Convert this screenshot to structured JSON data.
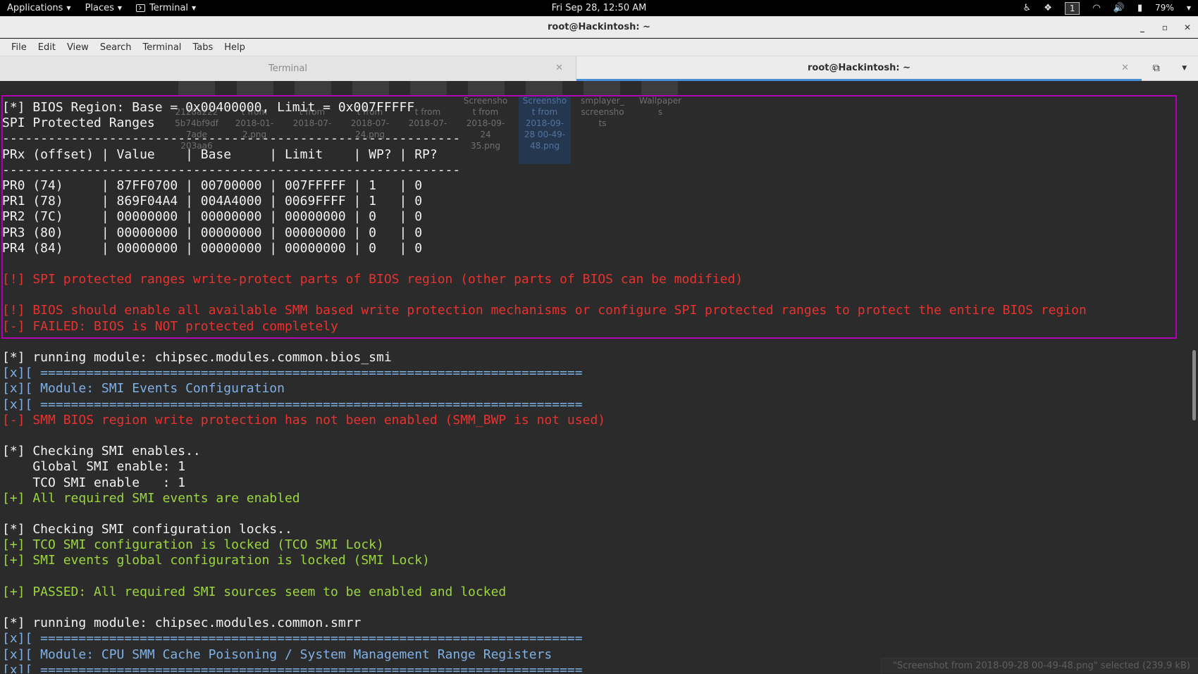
{
  "topbar": {
    "applications": "Applications",
    "places": "Places",
    "terminal": "Terminal",
    "clock": "Fri Sep 28, 12:50 AM",
    "workspace": "1",
    "battery": "79%"
  },
  "window": {
    "title": "root@Hackintosh: ~"
  },
  "menubar": {
    "items": [
      "File",
      "Edit",
      "View",
      "Search",
      "Terminal",
      "Tabs",
      "Help"
    ]
  },
  "tabs": [
    {
      "label": "Terminal",
      "active": false
    },
    {
      "label": "root@Hackintosh: ~",
      "active": true
    }
  ],
  "desktop_ghosts": {
    "files": [
      "2128a222\n5b74bf9df\n7ade\n203aa6",
      "t from\n2018-01-\n2.png",
      "t from\n2018-07-",
      "t from\n2018-07-\n24.png",
      "t from\n2018-07-",
      "Screensho\nt from\n2018-09-\n24\n35.png",
      "Screensho\nt from\n2018-09-\n28 00-49-\n48.png",
      "smplayer_\nscreensho\nts",
      "Wallpaper\ns"
    ],
    "status": "\"Screenshot from 2018-09-28 00-49-48.png\" selected (239.9 kB)"
  },
  "terminal": {
    "lines": [
      {
        "text": "[*] BIOS Region: Base = 0x00400000, Limit = 0x007FFFFF",
        "color": "white"
      },
      {
        "text": "SPI Protected Ranges",
        "color": "white"
      },
      {
        "text": "------------------------------------------------------------",
        "color": "white"
      },
      {
        "text": "PRx (offset) | Value    | Base     | Limit    | WP? | RP?",
        "color": "white"
      },
      {
        "text": "------------------------------------------------------------",
        "color": "white"
      },
      {
        "text": "PR0 (74)     | 87FF0700 | 00700000 | 007FFFFF | 1   | 0",
        "color": "white"
      },
      {
        "text": "PR1 (78)     | 869F04A4 | 004A4000 | 0069FFFF | 1   | 0",
        "color": "white"
      },
      {
        "text": "PR2 (7C)     | 00000000 | 00000000 | 00000000 | 0   | 0",
        "color": "white"
      },
      {
        "text": "PR3 (80)     | 00000000 | 00000000 | 00000000 | 0   | 0",
        "color": "white"
      },
      {
        "text": "PR4 (84)     | 00000000 | 00000000 | 00000000 | 0   | 0",
        "color": "white"
      },
      {
        "text": "",
        "color": "white"
      },
      {
        "text": "[!] SPI protected ranges write-protect parts of BIOS region (other parts of BIOS can be modified)",
        "color": "red"
      },
      {
        "text": "",
        "color": "white"
      },
      {
        "text": "[!] BIOS should enable all available SMM based write protection mechanisms or configure SPI protected ranges to protect the entire BIOS region",
        "color": "red"
      },
      {
        "text": "[-] FAILED: BIOS is NOT protected completely",
        "color": "red"
      },
      {
        "text": "",
        "color": "white"
      },
      {
        "text": "[*] running module: chipsec.modules.common.bios_smi",
        "color": "white"
      },
      {
        "text": "[x][ =======================================================================",
        "color": "blue"
      },
      {
        "text": "[x][ Module: SMI Events Configuration",
        "color": "blue"
      },
      {
        "text": "[x][ =======================================================================",
        "color": "blue"
      },
      {
        "text": "[-] SMM BIOS region write protection has not been enabled (SMM_BWP is not used)",
        "color": "red"
      },
      {
        "text": "",
        "color": "white"
      },
      {
        "text": "[*] Checking SMI enables..",
        "color": "white"
      },
      {
        "text": "    Global SMI enable: 1",
        "color": "white"
      },
      {
        "text": "    TCO SMI enable   : 1",
        "color": "white"
      },
      {
        "text": "[+] All required SMI events are enabled",
        "color": "green"
      },
      {
        "text": "",
        "color": "white"
      },
      {
        "text": "[*] Checking SMI configuration locks..",
        "color": "white"
      },
      {
        "text": "[+] TCO SMI configuration is locked (TCO SMI Lock)",
        "color": "green"
      },
      {
        "text": "[+] SMI events global configuration is locked (SMI Lock)",
        "color": "green"
      },
      {
        "text": "",
        "color": "white"
      },
      {
        "text": "[+] PASSED: All required SMI sources seem to be enabled and locked",
        "color": "green"
      },
      {
        "text": "",
        "color": "white"
      },
      {
        "text": "[*] running module: chipsec.modules.common.smrr",
        "color": "white"
      },
      {
        "text": "[x][ =======================================================================",
        "color": "blue"
      },
      {
        "text": "[x][ Module: CPU SMM Cache Poisoning / System Management Range Registers",
        "color": "blue"
      },
      {
        "text": "[x][ =======================================================================",
        "color": "blue"
      }
    ]
  },
  "colors": {
    "highlight_border": "#b100b1",
    "red": "#e8322f",
    "green": "#9bd540",
    "blue": "#7fb0e6",
    "tab_accent": "#4a90d9"
  }
}
